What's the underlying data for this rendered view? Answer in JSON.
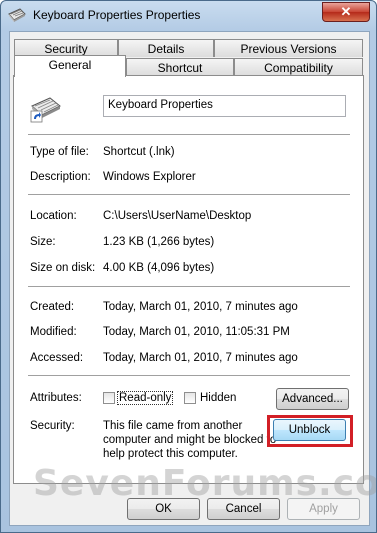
{
  "window": {
    "title": "Keyboard Properties Properties",
    "close_label": "✕"
  },
  "tabs": {
    "row1": [
      "Security",
      "Details",
      "Previous Versions"
    ],
    "row2": [
      "General",
      "Shortcut",
      "Compatibility"
    ],
    "active": "General"
  },
  "general": {
    "name_value": "Keyboard Properties",
    "type_of_file_label": "Type of file:",
    "type_of_file_value": "Shortcut (.lnk)",
    "description_label": "Description:",
    "description_value": "Windows Explorer",
    "location_label": "Location:",
    "location_value": "C:\\Users\\UserName\\Desktop",
    "size_label": "Size:",
    "size_value": "1.23 KB (1,266 bytes)",
    "size_on_disk_label": "Size on disk:",
    "size_on_disk_value": "4.00 KB (4,096 bytes)",
    "created_label": "Created:",
    "created_value": "Today, March 01, 2010, 7 minutes ago",
    "modified_label": "Modified:",
    "modified_value": "Today, March 01, 2010, 11:05:31 PM",
    "accessed_label": "Accessed:",
    "accessed_value": "Today, March 01, 2010, 7 minutes ago",
    "attributes_label": "Attributes:",
    "readonly_label": "Read-only",
    "hidden_label": "Hidden",
    "advanced_label": "Advanced...",
    "security_label": "Security:",
    "security_line1": "This file came from another",
    "security_line2": "computer and might be blocked to",
    "security_line3": "help protect this computer.",
    "unblock_label": "Unblock"
  },
  "footer": {
    "ok_label": "OK",
    "cancel_label": "Cancel",
    "apply_label": "Apply"
  },
  "watermark": "SevenForums.com",
  "colors": {
    "highlight_box": "#d21f26",
    "title_gradient_top": "#c9dcef"
  }
}
